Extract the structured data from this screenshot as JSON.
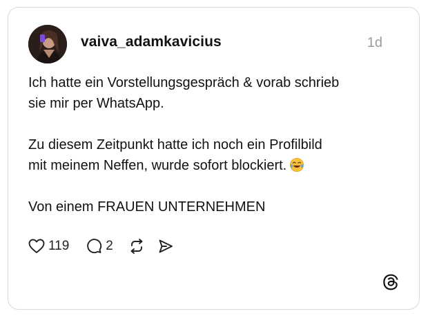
{
  "post": {
    "username": "vaiva_adamkavicius",
    "time": "1d",
    "lines": {
      "line1": "Ich hatte ein Vorstellungsgespräch & vorab schrieb",
      "line2": "sie mir per WhatsApp.",
      "line3": "Zu diesem Zeitpunkt hatte ich noch ein Profilbild",
      "line4": "mit meinem Neffen,  wurde sofort blockiert.",
      "line5": "Von einem FRAUEN UNTERNEHMEN"
    },
    "emoji": "face-with-tears-of-joy"
  },
  "actions": {
    "likes": "119",
    "replies": "2",
    "like_icon": "heart-icon",
    "reply_icon": "comment-icon",
    "repost_icon": "repost-icon",
    "share_icon": "send-icon"
  },
  "brand": {
    "logo": "threads-logo-icon"
  }
}
